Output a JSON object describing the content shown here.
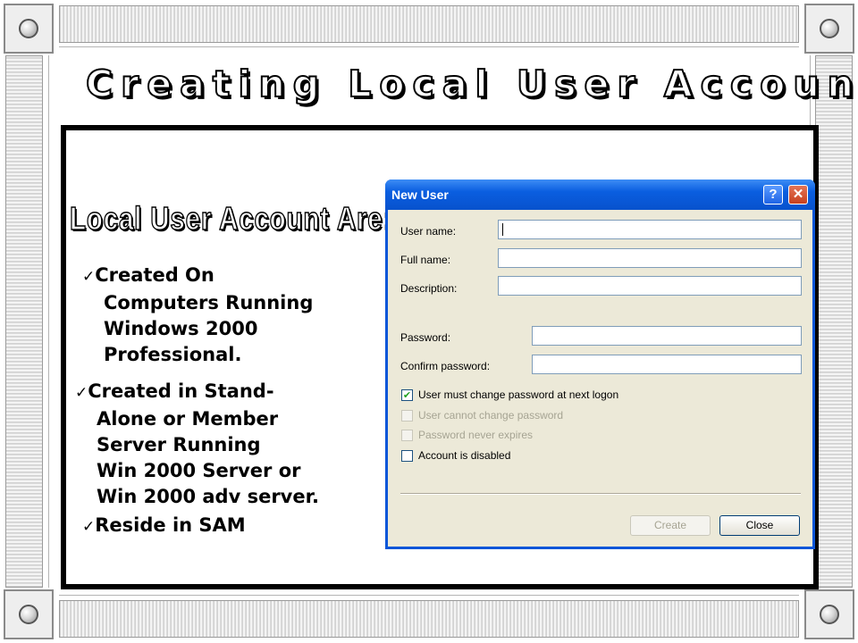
{
  "slide": {
    "title": "Creating Local User Account",
    "subtitle": "Local User Account Are:",
    "bullets": [
      {
        "check": "✓",
        "lines": [
          "Created On",
          "Computers Running",
          "Windows 2000",
          "Professional."
        ]
      },
      {
        "check": "✓",
        "lines": [
          "Created in Stand-",
          "Alone or Member",
          "Server Running",
          "Win 2000 Server or",
          "Win 2000 adv server."
        ]
      },
      {
        "check": "✓",
        "lines": [
          "Reside in SAM"
        ]
      }
    ]
  },
  "dialog": {
    "title": "New User",
    "help_glyph": "?",
    "close_glyph": "✕",
    "fields": {
      "username_label": "User name:",
      "username_value": "",
      "fullname_label": "Full name:",
      "fullname_value": "",
      "description_label": "Description:",
      "description_value": "",
      "password_label": "Password:",
      "password_value": "",
      "confirm_label": "Confirm password:",
      "confirm_value": ""
    },
    "checkboxes": [
      {
        "label": "User must change password at next logon",
        "checked": true,
        "enabled": true,
        "mark": "✔"
      },
      {
        "label": "User cannot change password",
        "checked": false,
        "enabled": false,
        "mark": ""
      },
      {
        "label": "Password never expires",
        "checked": false,
        "enabled": false,
        "mark": ""
      },
      {
        "label": "Account is disabled",
        "checked": false,
        "enabled": true,
        "mark": ""
      }
    ],
    "buttons": {
      "create": "Create",
      "close": "Close"
    }
  },
  "colors": {
    "titlebar_blue": "#0a5ee0",
    "dialog_face": "#ece9d8",
    "check_green": "#21a121",
    "disabled_text": "#a6a493"
  }
}
